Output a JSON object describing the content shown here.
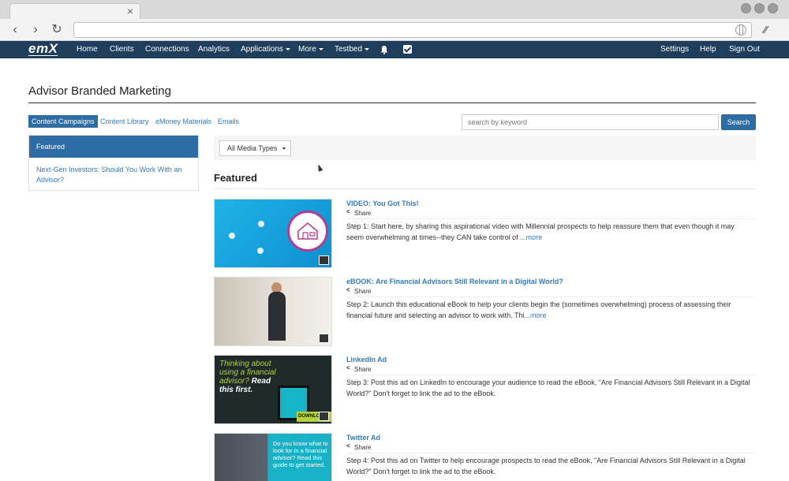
{
  "nav": {
    "logo": "emX",
    "items": [
      "Home",
      "Clients",
      "Connections",
      "Analytics"
    ],
    "dropdowns": [
      "Applications",
      "More",
      "Testbed"
    ],
    "right": [
      "Settings",
      "Help",
      "Sign Out"
    ]
  },
  "page": {
    "title": "Advisor Branded Marketing",
    "tabs": [
      "Content Campaigns",
      "Content Library",
      "eMoney Materials",
      "Emails"
    ],
    "search_placeholder": "search by keyword",
    "search_button": "Search"
  },
  "sidebar": {
    "header": "Featured",
    "link": "Next-Gen Investors: Should You Work With an Advisor?"
  },
  "filter": {
    "selected": "All Media Types"
  },
  "section_title": "Featured",
  "share_label": "Share",
  "more_label": "...more",
  "items": [
    {
      "title": "VIDEO: You Got This!",
      "desc": "Step 1: Start here, by sharing this aspirational video with Millennial prospects to help reassure them that even though it may seem overwhelming at times--they CAN take control of"
    },
    {
      "title": "eBOOK: Are Financial Advisors Still Relevant in a Digital World?",
      "desc": "Step 2: Launch this educational eBook to help your clients begin the (sometimes overwhelming) process of assessing their financial future and selecting an advisor to work with. Thi"
    },
    {
      "title": "LinkedIn Ad",
      "desc": "Step 3: Post this ad on LinkedIn to encourage your audience to read the eBook, \"Are Financial Advisors Still Relevant in a Digital World?\" Don't forget to link the ad to the eBook."
    },
    {
      "title": "Twitter Ad",
      "desc": "Step 4: Post this ad on Twitter to help encourage prospects to read the eBook, \"Are Financial Advisors Still Relevant in a Digital World?\" Don't forget to link the ad to the eBook."
    }
  ],
  "thumbs": {
    "linkedin_text1": "Thinking about using a financial advisor?",
    "linkedin_text2": "Read this first.",
    "linkedin_download": "DOWNLOAD",
    "twitter_text": "Do you know what to look for in a financial advisor? Read this guide to get started."
  }
}
